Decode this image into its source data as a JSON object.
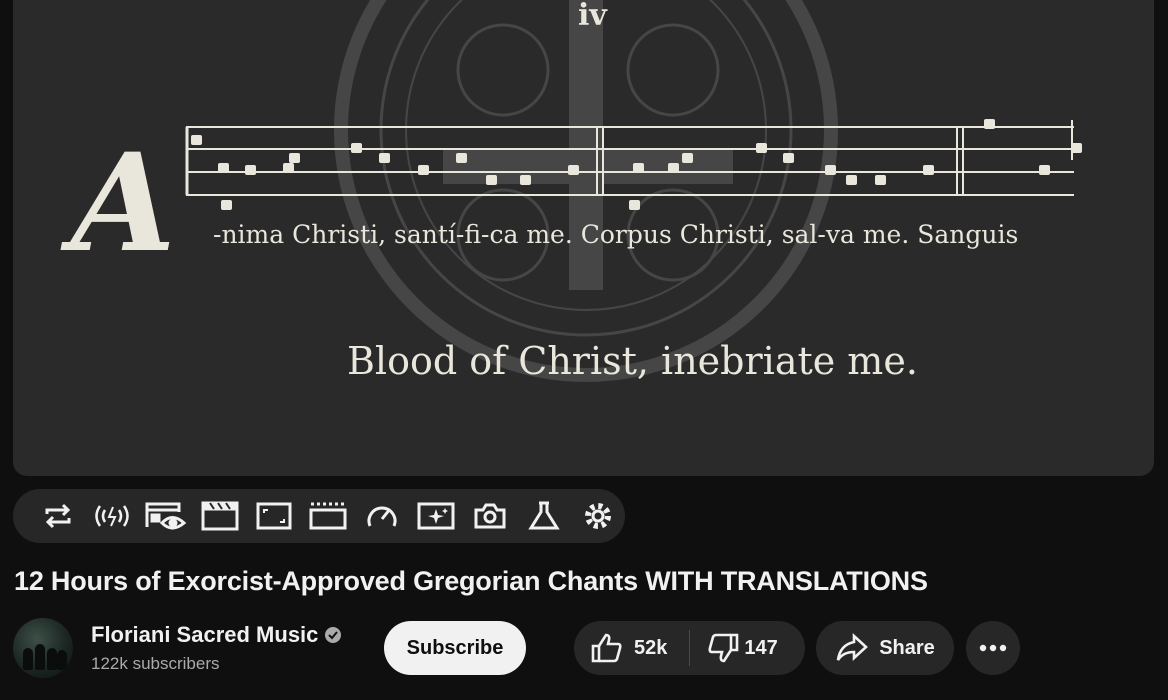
{
  "player": {
    "mode_numeral": "iv",
    "drop_cap": "A",
    "latin_lyrics": "-nima Christi, santí-fi-ca me.  Corpus Christi, sal-va me.  Sanguis",
    "translation": "Blood of Christ, inebriate me."
  },
  "toolbar": {
    "icons": [
      "repeat-icon",
      "live-audio-icon",
      "screen-view-icon",
      "clapperboard-icon",
      "aspect-ratio-icon",
      "subtitles-icon",
      "speed-gauge-icon",
      "ai-enhance-icon",
      "screenshot-camera-icon",
      "flask-icon",
      "settings-gear-icon"
    ]
  },
  "video": {
    "title": "12 Hours of Exorcist-Approved Gregorian Chants WITH TRANSLATIONS"
  },
  "channel": {
    "name": "Floriani Sacred Music",
    "subscribers": "122k subscribers",
    "subscribe_label": "Subscribe"
  },
  "actions": {
    "likes": "52k",
    "dislikes": "147",
    "share_label": "Share"
  },
  "colors": {
    "background": "#0f0f0f",
    "player_background": "#2a2a2a",
    "chant_ink": "#e9e6dc",
    "pill_background": "#272727"
  }
}
